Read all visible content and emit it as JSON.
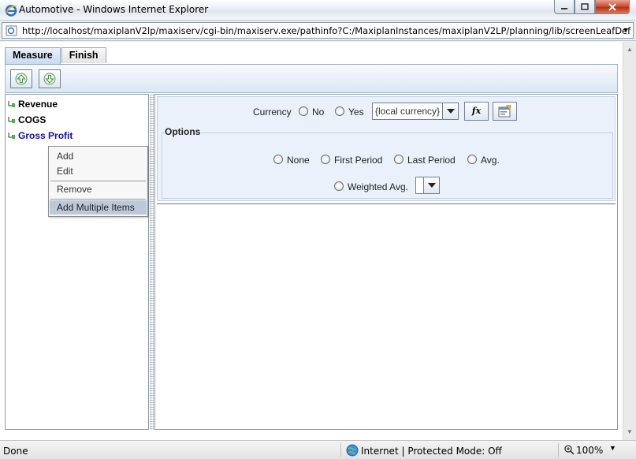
{
  "window": {
    "title": "Automotive - Windows Internet Explorer",
    "url": "http://localhost/maxiplanV2lp/maxiserv/cgi-bin/maxiserv.exe/pathinfo?C:/MaxiplanInstances/maxiplanV2LP/planning/lib/screenLeafDef"
  },
  "tabs": [
    {
      "label": "Measure",
      "active": true
    },
    {
      "label": "Finish",
      "active": false
    }
  ],
  "toolbar": {
    "up_icon": "arrow-up-icon",
    "down_icon": "arrow-down-icon"
  },
  "tree": {
    "items": [
      {
        "label": "Revenue"
      },
      {
        "label": "COGS"
      },
      {
        "label": "Gross Profit",
        "selected": true
      }
    ]
  },
  "context_menu": {
    "items": [
      "Add",
      "Edit",
      "Remove",
      "Add Multiple Items"
    ],
    "highlighted": "Add Multiple Items"
  },
  "props": {
    "currency_label": "Currency",
    "currency_no": "No",
    "currency_yes": "Yes",
    "currency_select": "{local currency}",
    "fx_label": "fx",
    "options_legend": "Options",
    "option_none": "None",
    "option_first_period": "First Period",
    "option_last_period": "Last Period",
    "option_avg": "Avg.",
    "option_weighted_avg": "Weighted Avg.",
    "weighted_select": ""
  },
  "status": {
    "text": "Done",
    "zone": "Internet | Protected Mode: Off",
    "zoom": "100%"
  },
  "colors": {
    "selected_tree_text": "#1010b0",
    "panel_bg": "#eaf1fa",
    "menu_highlight": "#bcc9da"
  }
}
